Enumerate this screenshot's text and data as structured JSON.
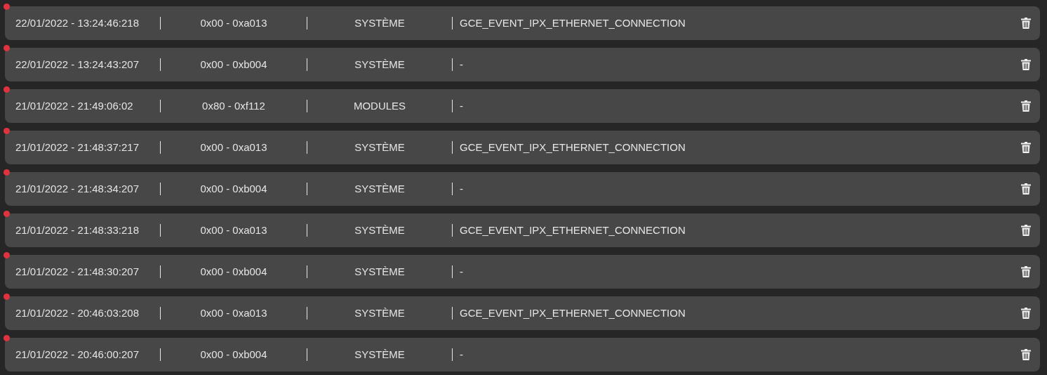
{
  "events": [
    {
      "timestamp": "22/01/2022 - 13:24:46:218",
      "code": "0x00 - 0xa013",
      "category": "SYSTÈME",
      "message": "GCE_EVENT_IPX_ETHERNET_CONNECTION",
      "color": "#e0323f"
    },
    {
      "timestamp": "22/01/2022 - 13:24:43:207",
      "code": "0x00 - 0xb004",
      "category": "SYSTÈME",
      "message": "-",
      "color": "#e0323f"
    },
    {
      "timestamp": "21/01/2022 - 21:49:06:02",
      "code": "0x80 - 0xf112",
      "category": "MODULES",
      "message": "-",
      "color": "#e0323f"
    },
    {
      "timestamp": "21/01/2022 - 21:48:37:217",
      "code": "0x00 - 0xa013",
      "category": "SYSTÈME",
      "message": "GCE_EVENT_IPX_ETHERNET_CONNECTION",
      "color": "#e0323f"
    },
    {
      "timestamp": "21/01/2022 - 21:48:34:207",
      "code": "0x00 - 0xb004",
      "category": "SYSTÈME",
      "message": "-",
      "color": "#e0323f"
    },
    {
      "timestamp": "21/01/2022 - 21:48:33:218",
      "code": "0x00 - 0xa013",
      "category": "SYSTÈME",
      "message": "GCE_EVENT_IPX_ETHERNET_CONNECTION",
      "color": "#e0323f"
    },
    {
      "timestamp": "21/01/2022 - 21:48:30:207",
      "code": "0x00 - 0xb004",
      "category": "SYSTÈME",
      "message": "-",
      "color": "#e0323f"
    },
    {
      "timestamp": "21/01/2022 - 20:46:03:208",
      "code": "0x00 - 0xa013",
      "category": "SYSTÈME",
      "message": "GCE_EVENT_IPX_ETHERNET_CONNECTION",
      "color": "#e0323f"
    },
    {
      "timestamp": "21/01/2022 - 20:46:00:207",
      "code": "0x00 - 0xb004",
      "category": "SYSTÈME",
      "message": "-",
      "color": "#e0323f"
    }
  ]
}
